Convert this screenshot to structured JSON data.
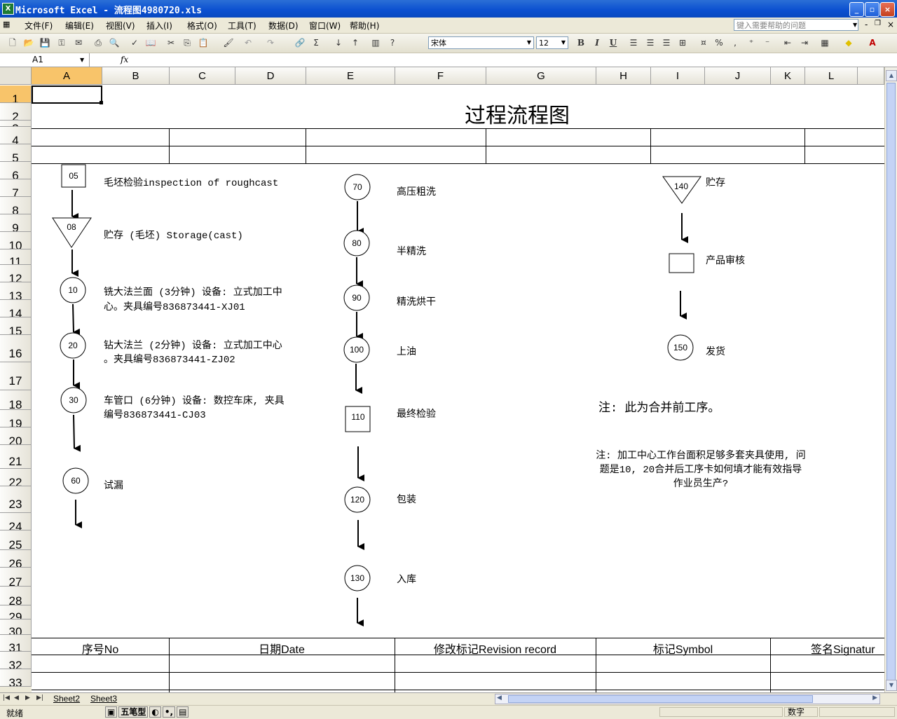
{
  "window": {
    "title": "Microsoft Excel - 流程图4980720.xls",
    "icon": "excel-icon",
    "controls": [
      "minimize",
      "maximize",
      "close"
    ]
  },
  "menubar": {
    "items": [
      "文件(F)",
      "编辑(E)",
      "视图(V)",
      "插入(I)",
      "格式(O)",
      "工具(T)",
      "数据(D)",
      "窗口(W)",
      "帮助(H)"
    ],
    "help_placeholder": "键入需要帮助的问题"
  },
  "toolbar": {
    "font_name": "宋体",
    "font_size": "12",
    "bold": "B",
    "italic": "I",
    "underline": "U",
    "percent": "%",
    "comma": ","
  },
  "formula_bar": {
    "name_box": "A1",
    "fx": "fx",
    "content": ""
  },
  "columns": [
    "A",
    "B",
    "C",
    "D",
    "E",
    "F",
    "G",
    "H",
    "I",
    "J",
    "K",
    "L"
  ],
  "selected_column": "A",
  "rows": [
    "1",
    "2",
    "3",
    "4",
    "5",
    "6",
    "7",
    "8",
    "9",
    "10",
    "11",
    "12",
    "13",
    "14",
    "15",
    "16",
    "17",
    "18",
    "19",
    "20",
    "21",
    "22",
    "23",
    "24",
    "25",
    "26",
    "27",
    "28",
    "29",
    "30",
    "31",
    "32",
    "33"
  ],
  "selected_row": "1",
  "sheet": {
    "title": "过程流程图",
    "left_steps": [
      {
        "no": "05",
        "shape": "square",
        "text": "毛坯检验inspection of roughcast"
      },
      {
        "no": "08",
        "shape": "triangle",
        "text": "贮存 (毛坯) Storage(cast)"
      },
      {
        "no": "10",
        "shape": "circle",
        "text_line1": "铣大法兰面 (3分钟) 设备: 立式加工中",
        "text_line2": "心。夹具编号836873441-XJ01"
      },
      {
        "no": "20",
        "shape": "circle",
        "text_line1": "钻大法兰 (2分钟) 设备: 立式加工中心",
        "text_line2": "。夹具编号836873441-ZJ02"
      },
      {
        "no": "30",
        "shape": "circle",
        "text_line1": "车管口 (6分钟) 设备: 数控车床, 夹具",
        "text_line2": "编号836873441-CJ03"
      },
      {
        "no": "60",
        "shape": "circle",
        "text": "试漏"
      }
    ],
    "middle_steps": [
      {
        "no": "70",
        "shape": "circle",
        "text": "高压粗洗"
      },
      {
        "no": "80",
        "shape": "circle",
        "text": "半精洗"
      },
      {
        "no": "90",
        "shape": "circle",
        "text": "精洗烘干"
      },
      {
        "no": "100",
        "shape": "circle",
        "text": "上油"
      },
      {
        "no": "110",
        "shape": "square",
        "text": "最终检验"
      },
      {
        "no": "120",
        "shape": "circle",
        "text": "包装"
      },
      {
        "no": "130",
        "shape": "circle",
        "text": "入库"
      }
    ],
    "right_steps": [
      {
        "no": "140",
        "shape": "triangle",
        "text": "贮存"
      },
      {
        "no": "",
        "shape": "square",
        "text": "产品审核"
      },
      {
        "no": "150",
        "shape": "circle",
        "text": "发货"
      }
    ],
    "note1": "注: 此为合并前工序。",
    "note2": "注: 加工中心工作台面积足够多套夹具使用, 问题是10, 20合并后工序卡如何填才能有效指导作业员生产?",
    "revision_headers": [
      "序号No",
      "日期Date",
      "修改标记Revision record",
      "标记Symbol",
      "签名Signatur"
    ]
  },
  "tabs": {
    "sheets": [
      "Sheet2",
      "Sheet3"
    ],
    "nav": [
      "|◀",
      "◀",
      "▶",
      "▶|"
    ]
  },
  "status": {
    "ready": "就绪",
    "mode": "数字",
    "ime_label": "五笔型"
  }
}
